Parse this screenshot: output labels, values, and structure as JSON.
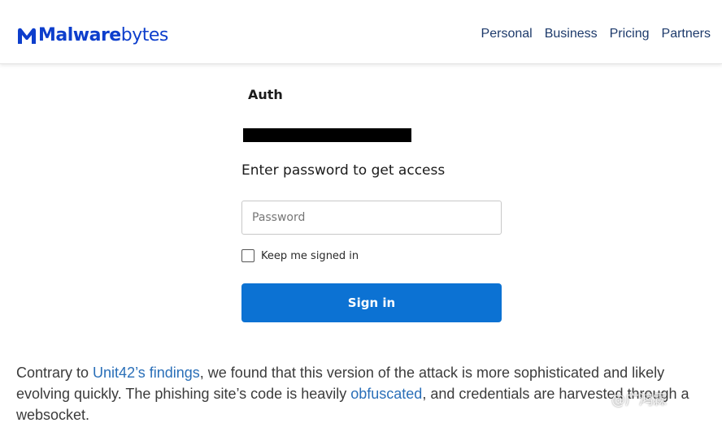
{
  "header": {
    "logo_bold": "Malware",
    "logo_light": "bytes",
    "nav": [
      "Personal",
      "Business",
      "Pricing",
      "Partners"
    ]
  },
  "login": {
    "title": "Auth",
    "heading": "Enter password to get access",
    "password_placeholder": "Password",
    "keep_signed_in": "Keep me signed in",
    "signin_label": "Sign in"
  },
  "article": {
    "t1": "Contrary to ",
    "link1": "Unit42’s findings",
    "t2": ", we found that this version of the attack is more sophisticated and likely evolving quickly. The phishing site’s code is heavily ",
    "link2": "obfuscated",
    "t3": ", and credentials are harvested through a websocket."
  },
  "watermark": "@广鸿霖",
  "colors": {
    "brand": "#0d3ecc",
    "nav": "#1d3a6b",
    "button": "#0c72d3",
    "link": "#2a6fb8"
  }
}
